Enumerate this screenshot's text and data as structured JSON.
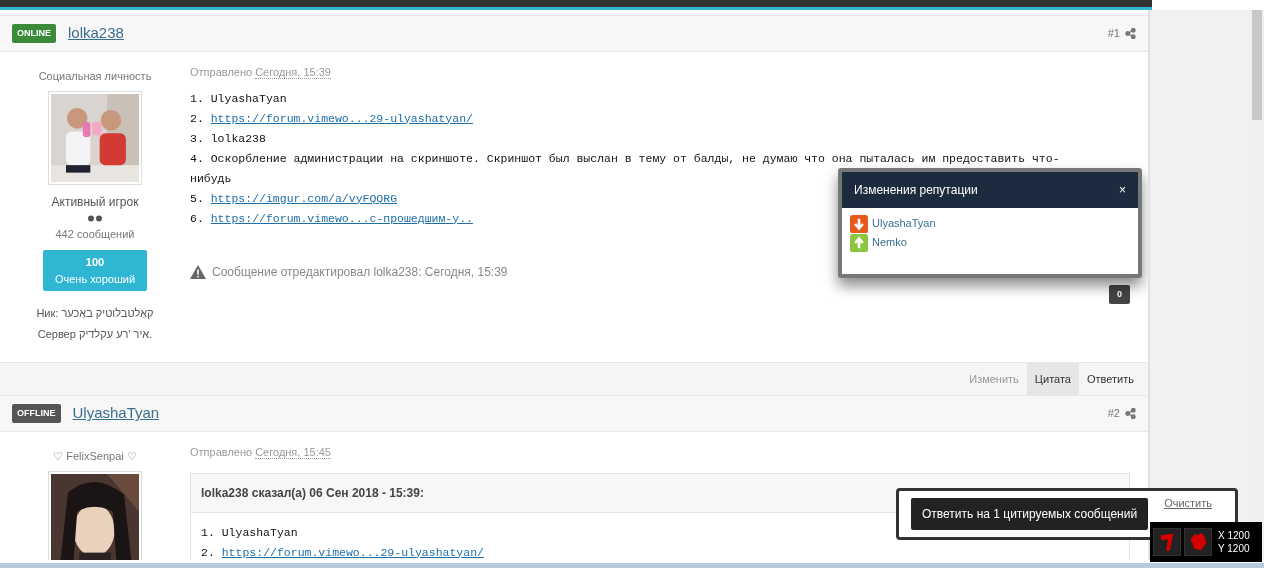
{
  "posts": [
    {
      "online": true,
      "status_badge": "ONLINE",
      "author": "lolka238",
      "number": "#1",
      "user_title": "Социальная личность",
      "rank": "Активный игрок",
      "post_count": "442 сообщений",
      "reputation": {
        "value": "100",
        "label": "Очень хороший"
      },
      "custom_fields": [
        "Ник: קאַלטבלוטיק באַכער",
        "Сервер איר 'רע עקלדיק."
      ],
      "posted_label": "Отправлено",
      "posted_time": "Сегодня, 15:39",
      "lines": [
        {
          "kind": "text",
          "number": "1.",
          "text": "UlyashaTyan"
        },
        {
          "kind": "link",
          "number": "2.",
          "text": "https://forum.vimewo...29-ulyashatyan/"
        },
        {
          "kind": "text",
          "number": "3.",
          "text": "lolka238"
        },
        {
          "kind": "text",
          "number": "4.",
          "text": "Оскорбление администрации на скриншоте. Скриншот был выслан в тему от балды, не думаю что она пыталась им предоставить что-нибудь"
        },
        {
          "kind": "link",
          "number": "5.",
          "text": "https://imgur.com/a/vyFQQRG"
        },
        {
          "kind": "link",
          "number": "6.",
          "text": "https://forum.vimewo...с-прошедшим-у.."
        }
      ],
      "edit_note": "Сообщение отредактировал lolka238: Сегодня, 15:39",
      "like_count": "0",
      "actions": [
        {
          "label": "Изменить",
          "disabled": true,
          "selected": false
        },
        {
          "label": "Цитата",
          "disabled": false,
          "selected": true
        },
        {
          "label": "Ответить",
          "disabled": false,
          "selected": false
        }
      ]
    },
    {
      "online": false,
      "status_badge": "OFFLINE",
      "author": "UlyashaTyan",
      "number": "#2",
      "user_title": "♡ FelixSenpai ♡",
      "posted_label": "Отправлено",
      "posted_time": "Сегодня, 15:45",
      "quote": {
        "header": "lolka238 сказал(а) 06 Сен 2018 - 15:39:",
        "lines": [
          {
            "kind": "text",
            "number": "1.",
            "text": "UlyashaTyan"
          },
          {
            "kind": "link",
            "number": "2.",
            "text": "https://forum.vimewo...29-ulyashatyan/"
          }
        ]
      }
    }
  ],
  "reputation_popup": {
    "title": "Изменения репутации",
    "close": "×",
    "entries": [
      {
        "name": "UlyashaTyan",
        "kind": "down"
      },
      {
        "name": "Nemko",
        "kind": "up"
      }
    ]
  },
  "quote_bar": {
    "button": "Ответить на 1 цитируемых сообщений",
    "clear": "Очистить"
  },
  "coords_widget": {
    "x": "X 1200",
    "y": "Y 1200"
  }
}
